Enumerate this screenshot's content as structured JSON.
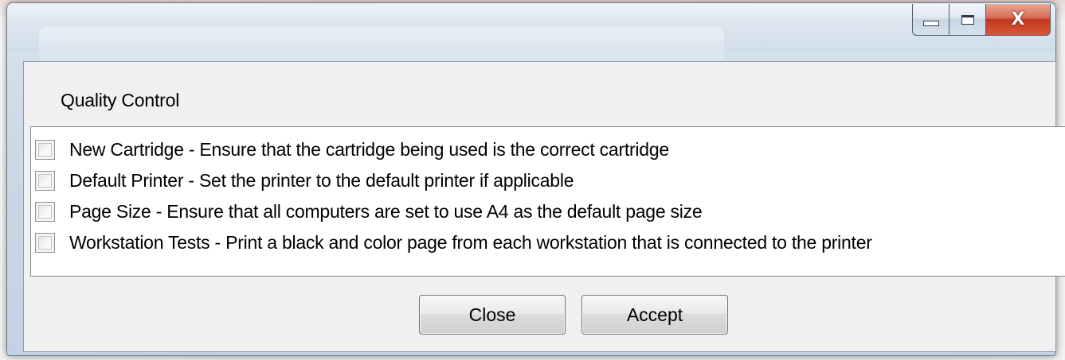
{
  "window": {
    "title": "",
    "controls": {
      "minimize_icon": "minimize-icon",
      "maximize_icon": "maximize-icon",
      "close_icon": "close-icon",
      "close_glyph": "X"
    },
    "close_button_color": "#c0391c"
  },
  "header": {
    "title": "Quality Control"
  },
  "checklist": {
    "items": [
      {
        "label": "New Cartridge - Ensure that the cartridge being used is the correct cartridge",
        "checked": false
      },
      {
        "label": "Default Printer - Set the printer to the default printer if applicable",
        "checked": false
      },
      {
        "label": "Page Size - Ensure that all computers are set to use A4 as the default page size",
        "checked": false
      },
      {
        "label": "Workstation Tests - Print a black and color page from each workstation that is connected to the printer",
        "checked": false
      }
    ]
  },
  "actions": {
    "close_label": "Close",
    "accept_label": "Accept"
  }
}
